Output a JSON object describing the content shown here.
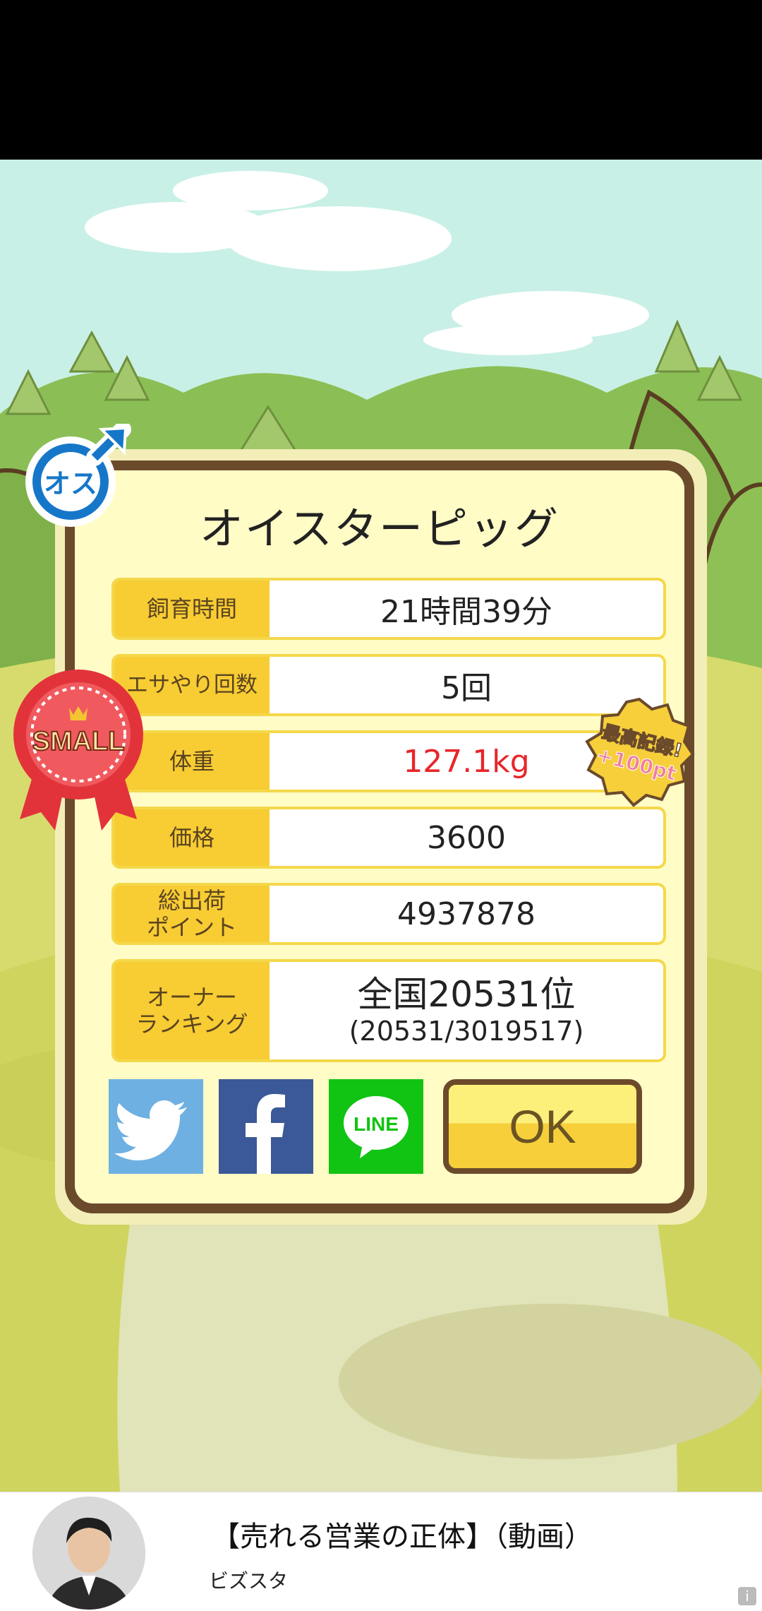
{
  "panel": {
    "title": "オイスターピッグ",
    "rows": [
      {
        "label": "飼育時間",
        "value": "21時間39分"
      },
      {
        "label": "エサやり回数",
        "value": "5回"
      },
      {
        "label": "体重",
        "value": "127.1kg"
      },
      {
        "label": "価格",
        "value": "3600"
      },
      {
        "label": "総出荷\nポイント",
        "value": "4937878"
      }
    ],
    "ranking": {
      "label": "オーナー\nランキング",
      "rank": "全国20531位",
      "detail": "(20531/3019517)"
    },
    "ok_label": "OK"
  },
  "badges": {
    "gender": "オス",
    "size": "SMALL",
    "record_line1": "最高記録!",
    "record_line2": "+100pt"
  },
  "share": {
    "twitter": "twitter-icon",
    "facebook": "facebook-icon",
    "line": "LINE"
  },
  "ad": {
    "title": "【売れる営業の正体】（動画）",
    "advertiser": "ビズスタ",
    "info_icon": "i"
  },
  "colors": {
    "value_highlight": "#e8262a",
    "label_bg": "#f8cc33",
    "frame": "#6b4a2b"
  }
}
